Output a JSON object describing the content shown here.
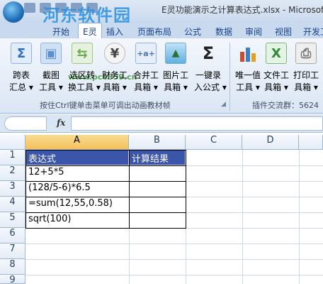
{
  "window": {
    "title": "E灵功能演示之计算表达式.xlsx - Microsoft",
    "watermark": "河东软件园",
    "watermark_url": "www.pc0359.cn"
  },
  "tabs": [
    {
      "label": "开始"
    },
    {
      "label": "E灵"
    },
    {
      "label": "插入"
    },
    {
      "label": "页面布局"
    },
    {
      "label": "公式"
    },
    {
      "label": "数据"
    },
    {
      "label": "审阅"
    },
    {
      "label": "视图"
    },
    {
      "label": "开发工"
    }
  ],
  "ribbon": {
    "buttons": [
      {
        "line1": "跨表",
        "line2": "汇总 ▾",
        "icon": "sigma-table-icon",
        "color": "#2c6fbf",
        "glyph": "Σ"
      },
      {
        "line1": "截图",
        "line2": "工具 ▾",
        "icon": "screenshot-icon",
        "color": "#5a8fd0",
        "glyph": "▣"
      },
      {
        "line1": "选区转",
        "line2": "换工具 ▾",
        "icon": "range-convert-icon",
        "color": "#6aa84f",
        "glyph": "⇆"
      },
      {
        "line1": "财务工",
        "line2": "具箱 ▾",
        "icon": "yen-icon",
        "color": "#444444",
        "glyph": "¥"
      },
      {
        "line1": "合并工",
        "line2": "具箱 ▾",
        "icon": "merge-icon",
        "color": "#4a78b5",
        "glyph": "+a+"
      },
      {
        "line1": "图片工",
        "line2": "具箱 ▾",
        "icon": "picture-icon",
        "color": "#4aa0d8",
        "glyph": "▲"
      },
      {
        "line1": "一键录",
        "line2": "入公式 ▾",
        "icon": "sum-formula-icon",
        "color": "#222222",
        "glyph": "Σ"
      },
      {
        "line1": "唯一值",
        "line2": "工具 ▾",
        "icon": "bar-chart-icon",
        "color": "#d04a2c",
        "glyph": "▮"
      },
      {
        "line1": "文件工",
        "line2": "具箱 ▾",
        "icon": "excel-file-icon",
        "color": "#2e8b3a",
        "glyph": "X"
      },
      {
        "line1": "打印工",
        "line2": "具箱 ▾",
        "icon": "printer-icon",
        "color": "#777777",
        "glyph": "⎙"
      }
    ],
    "group_label_left": "按住Ctrl键单击菜单可调出动画教材帧",
    "group_label_right": "插件交流群：5624"
  },
  "formula_bar": {
    "fx_label": "fx",
    "name_box": "",
    "content": ""
  },
  "sheet": {
    "columns": [
      "A",
      "B",
      "C",
      "D"
    ],
    "rows": [
      "1",
      "2",
      "3",
      "4",
      "5",
      "6",
      "7",
      "8",
      "9"
    ],
    "cells": {
      "A1": "表达式",
      "B1": "计算结果",
      "A2": "12+5*5",
      "A3": "(128/5-6)*6.5",
      "A4": "=sum(12,55,0.58)",
      "A5": "sqrt(100)"
    }
  },
  "colors": {
    "header_fill": "#3b55a8",
    "selected_header": "#f4c15c",
    "tab_text": "#15428b"
  }
}
